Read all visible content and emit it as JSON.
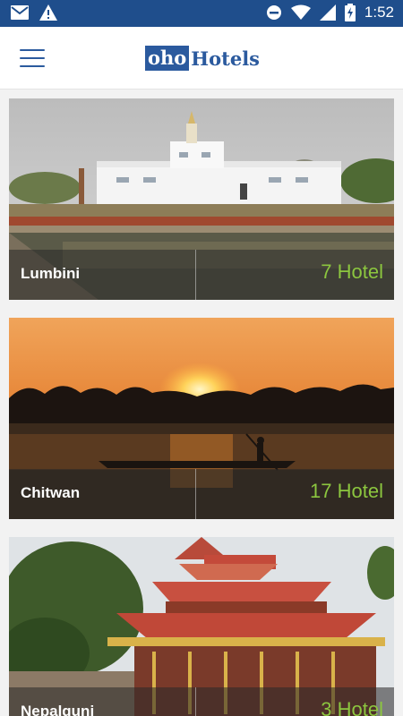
{
  "status_bar": {
    "time": "1:52",
    "icons": [
      "mail-icon",
      "warning-icon",
      "do-not-disturb-icon",
      "wifi-icon",
      "signal-icon",
      "battery-charging-icon"
    ]
  },
  "app_bar": {
    "logo_part1": "oho",
    "logo_part2": "Hotels",
    "menu_icon": "hamburger-menu-icon"
  },
  "destinations": [
    {
      "city": "Lumbini",
      "count": "7 Hotel"
    },
    {
      "city": "Chitwan",
      "count": "17 Hotel"
    },
    {
      "city": "Nepalgunj",
      "count": "3 Hotel"
    }
  ],
  "colors": {
    "primary": "#1f4e8c",
    "accent_green": "#8cc63f"
  }
}
